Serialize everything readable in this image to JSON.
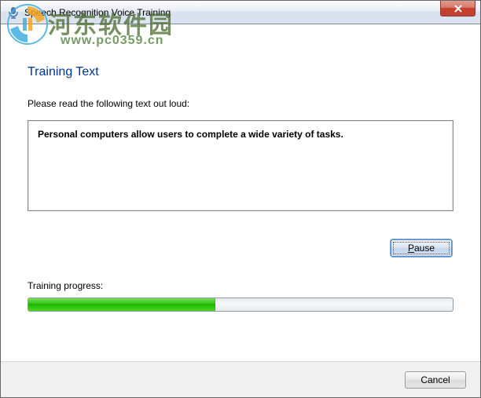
{
  "window": {
    "title": "Speech Recognition Voice Training"
  },
  "watermark": {
    "text_cn": "河东软件园",
    "url": "www.pc0359.cn"
  },
  "page": {
    "heading": "Training Text",
    "instruction": "Please read the following text out loud:",
    "training_text": "Personal computers allow users to complete a wide variety of tasks.",
    "pause_prefix": "P",
    "pause_rest": "ause",
    "progress_label": "Training progress:",
    "progress_percent": 44
  },
  "footer": {
    "cancel_label": "Cancel"
  }
}
